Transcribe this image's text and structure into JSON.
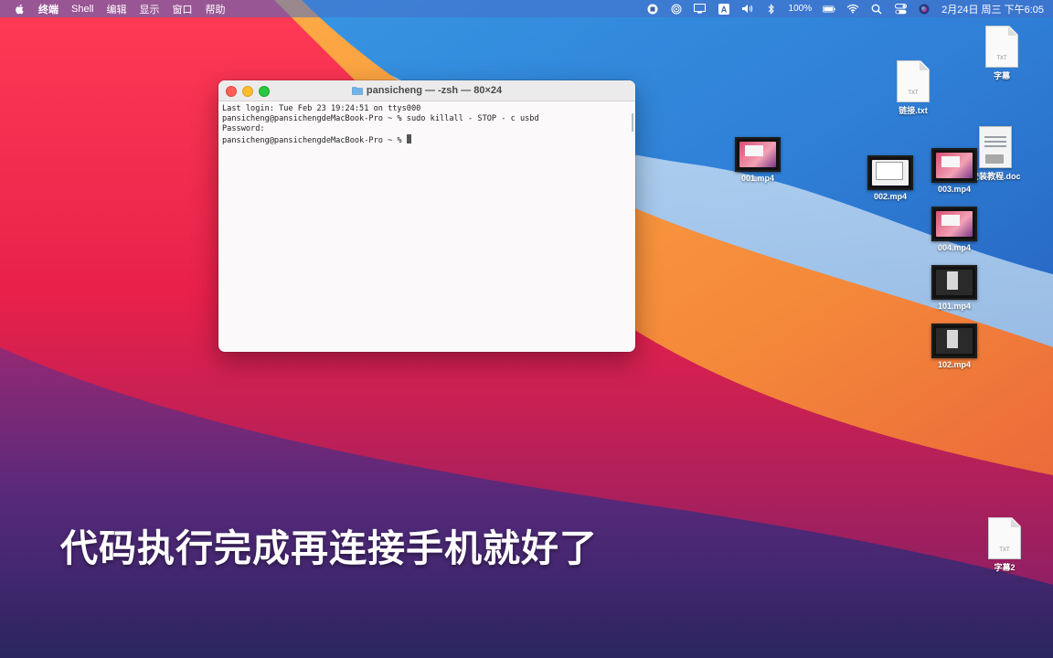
{
  "menubar": {
    "app_name": "终端",
    "items": [
      "Shell",
      "编辑",
      "显示",
      "窗口",
      "帮助"
    ],
    "battery": "100%",
    "clock": "2月24日 周三 下午6:05"
  },
  "terminal": {
    "title": "pansicheng — -zsh — 80×24",
    "lines": [
      "Last login: Tue Feb 23 19:24:51 on ttys000",
      "pansicheng@pansichengdeMacBook-Pro ~ % sudo killall - STOP - c usbd",
      "Password:",
      "pansicheng@pansichengdeMacBook-Pro ~ % "
    ]
  },
  "desktop": {
    "icons": [
      {
        "label": "字幕",
        "ext": "TXT"
      },
      {
        "label": "链接.txt",
        "ext": "TXT"
      },
      {
        "label": "安装教程.doc"
      },
      {
        "label": "001.mp4"
      },
      {
        "label": "002.mp4"
      },
      {
        "label": "003.mp4"
      },
      {
        "label": "004.mp4"
      },
      {
        "label": "101.mp4"
      },
      {
        "label": "102.mp4"
      },
      {
        "label": "字幕2",
        "ext": "TXT"
      }
    ]
  },
  "subtitle": "代码执行完成再连接手机就好了",
  "colors": {
    "terminal_bg": "#fbf9fa",
    "close": "#fe5f57",
    "minimize": "#febc2e",
    "maximize": "#28c840"
  }
}
